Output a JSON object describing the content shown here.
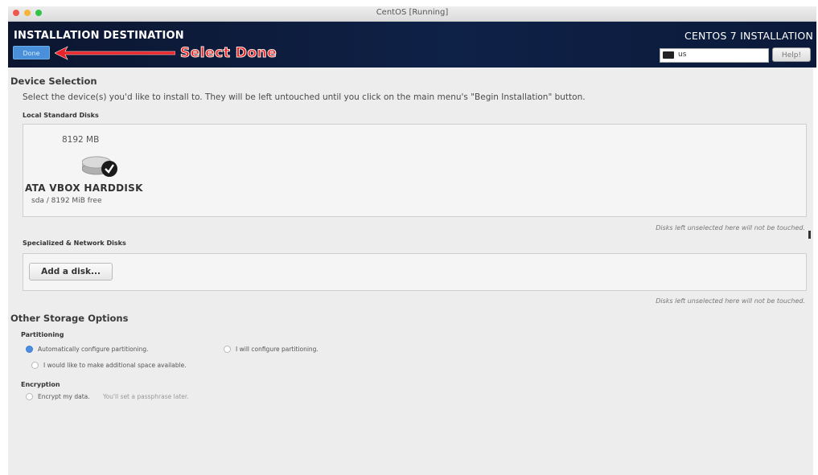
{
  "window": {
    "title": "CentOS [Running]"
  },
  "header": {
    "title": "INSTALLATION DESTINATION",
    "done_label": "Done",
    "annotation": "Select Done",
    "product": "CENTOS 7 INSTALLATION",
    "keyboard_layout": "us",
    "help_label": "Help!"
  },
  "device_selection": {
    "title": "Device Selection",
    "description": "Select the device(s) you'd like to install to.  They will be left untouched until you click on the main menu's \"Begin Installation\" button.",
    "local_label": "Local Standard Disks",
    "disk": {
      "size": "8192 MB",
      "name": "ATA VBOX HARDDISK",
      "free": "sda  /  8192 MiB free"
    },
    "local_note": "Disks left unselected here will not be touched.",
    "network_label": "Specialized & Network Disks",
    "add_disk_label": "Add a disk...",
    "network_note": "Disks left unselected here will not be touched."
  },
  "storage_options": {
    "title": "Other Storage Options",
    "partitioning_label": "Partitioning",
    "auto_partition": "Automatically configure partitioning.",
    "manual_partition": "I will configure partitioning.",
    "additional_space": "I would like to make additional space available.",
    "encryption_label": "Encryption",
    "encrypt_label": "Encrypt my data.",
    "encrypt_hint": "You'll set a passphrase later."
  },
  "colors": {
    "header_bg": "#0e2147",
    "accent_blue": "#4a8fd9",
    "annotation_red": "#e8242a"
  }
}
